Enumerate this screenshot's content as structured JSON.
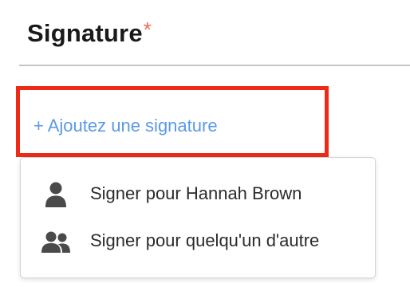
{
  "field": {
    "title": "Signature",
    "required_marker": "*"
  },
  "action": {
    "add_signature_label": "+ Ajoutez une signature"
  },
  "menu": {
    "items": [
      {
        "label": "Signer pour Hannah Brown",
        "icon": "person-icon"
      },
      {
        "label": "Signer pour quelqu'un d'autre",
        "icon": "people-icon"
      }
    ]
  },
  "colors": {
    "required_marker": "#f06a5b",
    "link": "#5b9ae6",
    "highlight_border": "#ee2a17",
    "icon": "#4a4a4a"
  }
}
